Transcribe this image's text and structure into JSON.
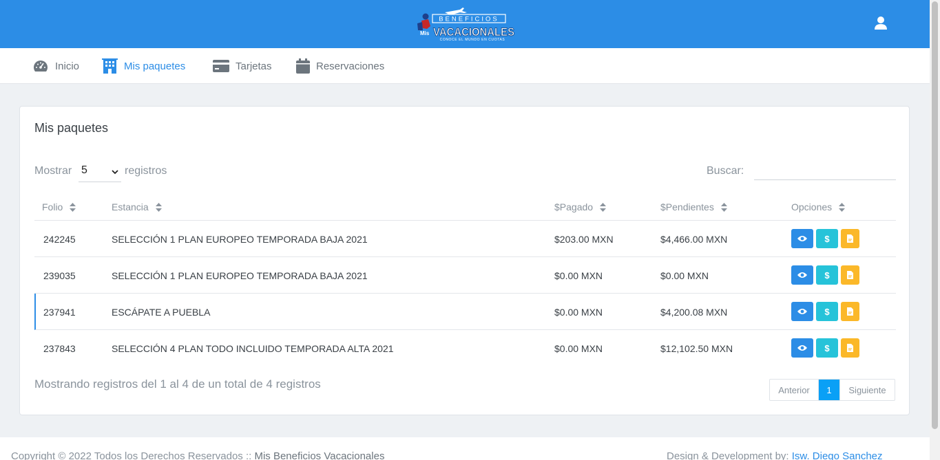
{
  "header": {
    "logo_top": "BENEFICIOS",
    "logo_mis": "Mis",
    "logo_main": "VACACIONALES",
    "logo_tagline": "CONOCE EL MUNDO EN CUOTAS"
  },
  "nav": {
    "items": [
      {
        "label": "Inicio",
        "icon": "speedometer-icon"
      },
      {
        "label": "Mis paquetes",
        "icon": "building-icon"
      },
      {
        "label": "Tarjetas",
        "icon": "credit-card-icon"
      },
      {
        "label": "Reservaciones",
        "icon": "calendar-icon"
      }
    ],
    "active": "Mis paquetes"
  },
  "card": {
    "title": "Mis paquetes",
    "show_label": "Mostrar",
    "show_value": "5",
    "records_label": "registros",
    "search_label": "Buscar:",
    "search_value": ""
  },
  "table": {
    "columns": [
      "Folio",
      "Estancia",
      "$Pagado",
      "$Pendientes",
      "Opciones"
    ],
    "rows": [
      {
        "folio": "242245",
        "estancia": "SELECCIÓN 1 PLAN EUROPEO TEMPORADA BAJA 2021",
        "pagado": "$203.00 MXN",
        "pendientes": "$4,466.00 MXN"
      },
      {
        "folio": "239035",
        "estancia": "SELECCIÓN 1 PLAN EUROPEO TEMPORADA BAJA 2021",
        "pagado": "$0.00 MXN",
        "pendientes": "$0.00 MXN"
      },
      {
        "folio": "237941",
        "estancia": "ESCÁPATE A PUEBLA",
        "pagado": "$0.00 MXN",
        "pendientes": "$4,200.08 MXN"
      },
      {
        "folio": "237843",
        "estancia": "SELECCIÓN 4 PLAN TODO INCLUIDO TEMPORADA ALTA 2021",
        "pagado": "$0.00 MXN",
        "pendientes": "$12,102.50 MXN"
      }
    ]
  },
  "info": "Mostrando registros del 1 al 4 de un total de 4 registros",
  "pagination": {
    "prev": "Anterior",
    "current": "1",
    "next": "Siguiente"
  },
  "footer": {
    "copyright": "Copyright © 2022 Todos los Derechos Reservados :: ",
    "brand": "Mis Beneficios Vacacionales",
    "credit": "Design & Development by: ",
    "author": "Isw. Diego Sanchez"
  },
  "colors": {
    "primary": "#2c8de6",
    "view_button": "#2c8de6",
    "pay_button": "#26c3d9",
    "pdf_button": "#fbb829",
    "current_page": "#0aa0f6"
  }
}
